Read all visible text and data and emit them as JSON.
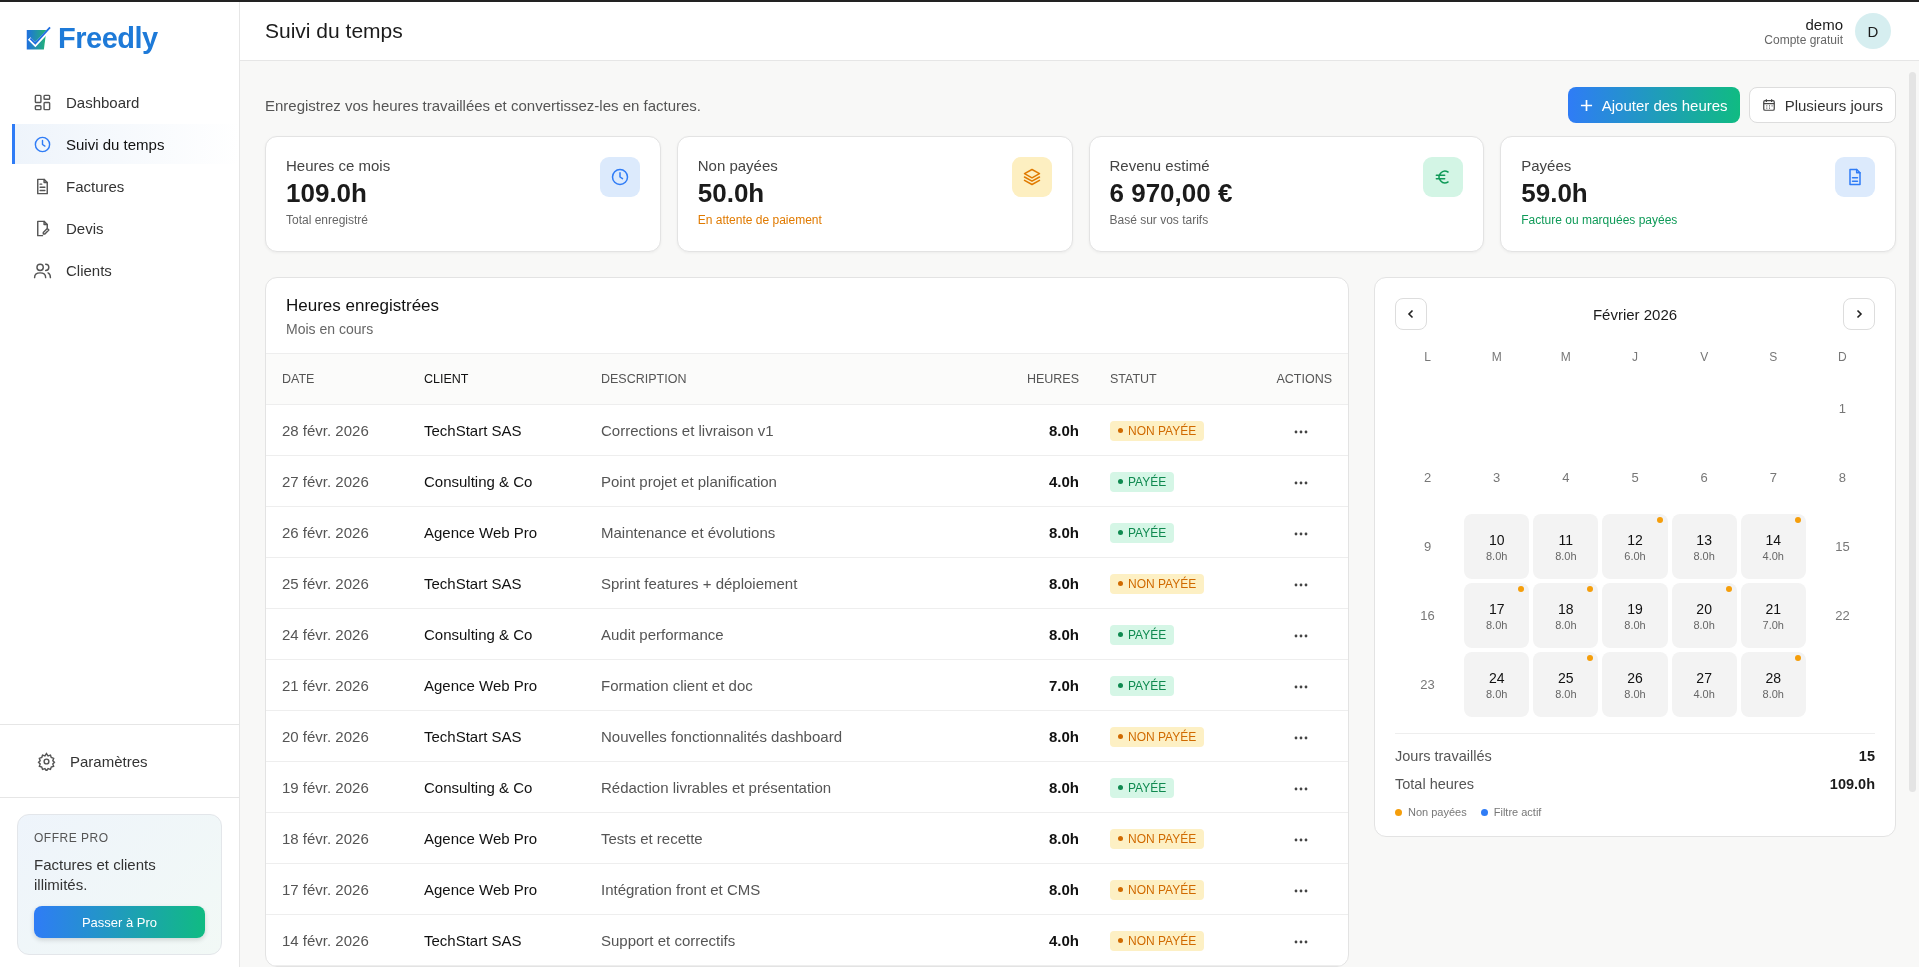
{
  "brand": {
    "name": "Freedly"
  },
  "sidebar": {
    "items": [
      {
        "label": "Dashboard",
        "kind": "grid",
        "selected": false
      },
      {
        "label": "Suivi du temps",
        "kind": "clock",
        "selected": true
      },
      {
        "label": "Factures",
        "kind": "file",
        "selected": false
      },
      {
        "label": "Devis",
        "kind": "edit",
        "selected": false
      },
      {
        "label": "Clients",
        "kind": "users",
        "selected": false
      }
    ],
    "settings": "Paramètres",
    "promo": {
      "label": "OFFRE PRO",
      "text": "Factures et clients illimités.",
      "button": "Passer à Pro"
    }
  },
  "header": {
    "title": "Suivi du temps",
    "user": {
      "name": "demo",
      "plan": "Compte gratuit",
      "initial": "D"
    }
  },
  "intro": "Enregistrez vos heures travaillées et convertissez-les en factures.",
  "actions": {
    "primary": "Ajouter des heures",
    "secondary": "Plusieurs jours"
  },
  "stats": [
    {
      "kind": "hours",
      "label": "Heures ce mois",
      "value": "109.0h",
      "note": "Total enregistré"
    },
    {
      "kind": "unpaid",
      "label": "Non payées",
      "value": "50.0h",
      "note": "En attente de paiement"
    },
    {
      "kind": "revenue",
      "label": "Revenu estimé",
      "value": "6 970,00 €",
      "note": "Basé sur vos tarifs"
    },
    {
      "kind": "paid",
      "label": "Payées",
      "value": "59.0h",
      "note": "Facture ou marquées payées"
    }
  ],
  "table": {
    "title": "Heures enregistrées",
    "subtitle": "Mois en cours",
    "columns": [
      "DATE",
      "CLIENT",
      "DESCRIPTION",
      "HEURES",
      "STATUT",
      "ACTIONS"
    ],
    "rows": [
      {
        "date": "28 févr. 2026",
        "client": "TechStart SAS",
        "description": "Corrections et livraison v1",
        "hours": "8.0h",
        "status": "NON PAYÉE",
        "paid": false
      },
      {
        "date": "27 févr. 2026",
        "client": "Consulting & Co",
        "description": "Point projet et planification",
        "hours": "4.0h",
        "status": "PAYÉE",
        "paid": true
      },
      {
        "date": "26 févr. 2026",
        "client": "Agence Web Pro",
        "description": "Maintenance et évolutions",
        "hours": "8.0h",
        "status": "PAYÉE",
        "paid": true
      },
      {
        "date": "25 févr. 2026",
        "client": "TechStart SAS",
        "description": "Sprint features + déploiement",
        "hours": "8.0h",
        "status": "NON PAYÉE",
        "paid": false
      },
      {
        "date": "24 févr. 2026",
        "client": "Consulting & Co",
        "description": "Audit performance",
        "hours": "8.0h",
        "status": "PAYÉE",
        "paid": true
      },
      {
        "date": "21 févr. 2026",
        "client": "Agence Web Pro",
        "description": "Formation client et doc",
        "hours": "7.0h",
        "status": "PAYÉE",
        "paid": true
      },
      {
        "date": "20 févr. 2026",
        "client": "TechStart SAS",
        "description": "Nouvelles fonctionnalités dashboard",
        "hours": "8.0h",
        "status": "NON PAYÉE",
        "paid": false
      },
      {
        "date": "19 févr. 2026",
        "client": "Consulting & Co",
        "description": "Rédaction livrables et présentation",
        "hours": "8.0h",
        "status": "PAYÉE",
        "paid": true
      },
      {
        "date": "18 févr. 2026",
        "client": "Agence Web Pro",
        "description": "Tests et recette",
        "hours": "8.0h",
        "status": "NON PAYÉE",
        "paid": false
      },
      {
        "date": "17 févr. 2026",
        "client": "Agence Web Pro",
        "description": "Intégration front et CMS",
        "hours": "8.0h",
        "status": "NON PAYÉE",
        "paid": false
      },
      {
        "date": "14 févr. 2026",
        "client": "TechStart SAS",
        "description": "Support et correctifs",
        "hours": "4.0h",
        "status": "NON PAYÉE",
        "paid": false
      }
    ]
  },
  "calendar": {
    "title": "Février 2026",
    "weekdays": [
      "L",
      "M",
      "M",
      "J",
      "V",
      "S",
      "D"
    ],
    "days": [
      {
        "kind": "empty"
      },
      {
        "kind": "empty"
      },
      {
        "kind": "empty"
      },
      {
        "kind": "empty"
      },
      {
        "kind": "empty"
      },
      {
        "kind": "empty"
      },
      {
        "kind": "plain",
        "day": "1"
      },
      {
        "kind": "plain",
        "day": "2"
      },
      {
        "kind": "plain",
        "day": "3"
      },
      {
        "kind": "plain",
        "day": "4"
      },
      {
        "kind": "plain",
        "day": "5"
      },
      {
        "kind": "plain",
        "day": "6"
      },
      {
        "kind": "plain",
        "day": "7"
      },
      {
        "kind": "plain",
        "day": "8"
      },
      {
        "kind": "plain",
        "day": "9"
      },
      {
        "kind": "worked",
        "day": "10",
        "hours": "8.0h",
        "unpaid": false
      },
      {
        "kind": "worked",
        "day": "11",
        "hours": "8.0h",
        "unpaid": false
      },
      {
        "kind": "worked",
        "day": "12",
        "hours": "6.0h",
        "unpaid": true
      },
      {
        "kind": "worked",
        "day": "13",
        "hours": "8.0h",
        "unpaid": false
      },
      {
        "kind": "worked",
        "day": "14",
        "hours": "4.0h",
        "unpaid": true
      },
      {
        "kind": "plain",
        "day": "15"
      },
      {
        "kind": "plain",
        "day": "16"
      },
      {
        "kind": "worked",
        "day": "17",
        "hours": "8.0h",
        "unpaid": true
      },
      {
        "kind": "worked",
        "day": "18",
        "hours": "8.0h",
        "unpaid": true
      },
      {
        "kind": "worked",
        "day": "19",
        "hours": "8.0h",
        "unpaid": false
      },
      {
        "kind": "worked",
        "day": "20",
        "hours": "8.0h",
        "unpaid": true
      },
      {
        "kind": "worked",
        "day": "21",
        "hours": "7.0h",
        "unpaid": false
      },
      {
        "kind": "plain",
        "day": "22"
      },
      {
        "kind": "plain",
        "day": "23"
      },
      {
        "kind": "worked",
        "day": "24",
        "hours": "8.0h",
        "unpaid": false
      },
      {
        "kind": "worked",
        "day": "25",
        "hours": "8.0h",
        "unpaid": true
      },
      {
        "kind": "worked",
        "day": "26",
        "hours": "8.0h",
        "unpaid": false
      },
      {
        "kind": "worked",
        "day": "27",
        "hours": "4.0h",
        "unpaid": false
      },
      {
        "kind": "worked",
        "day": "28",
        "hours": "8.0h",
        "unpaid": true
      }
    ],
    "summary": [
      {
        "label": "Jours travaillés",
        "value": "15"
      },
      {
        "label": "Total heures",
        "value": "109.0h"
      }
    ],
    "legend": [
      {
        "label": "Non payées",
        "color": "#f59e0b"
      },
      {
        "label": "Filtre actif",
        "color": "#2f7cf6"
      }
    ]
  }
}
